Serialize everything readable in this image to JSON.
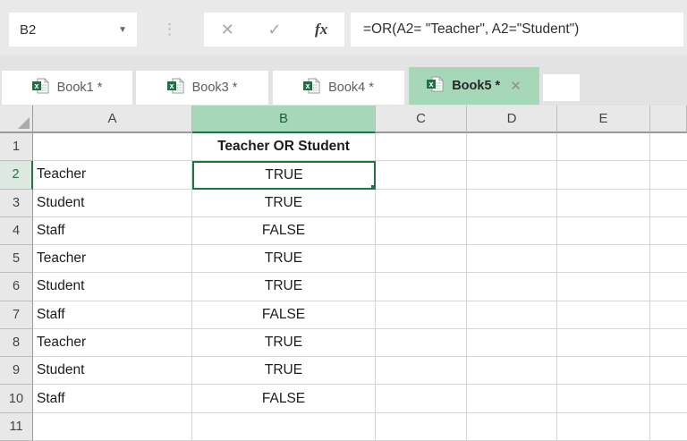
{
  "formula_bar": {
    "name_box_value": "B2",
    "formula": "=OR(A2= \"Teacher\", A2=\"Student\")",
    "fx_label": "fx"
  },
  "icons": {
    "dropdown": "▼",
    "separator_dots": "⋮",
    "cancel": "✕",
    "enter": "✓",
    "tab_close": "✕"
  },
  "tabs": [
    {
      "label": "Book1 *",
      "active": false
    },
    {
      "label": "Book3 *",
      "active": false
    },
    {
      "label": "Book4 *",
      "active": false
    },
    {
      "label": "Book5 *",
      "active": true
    }
  ],
  "grid": {
    "columns": [
      "A",
      "B",
      "C",
      "D",
      "E"
    ],
    "selection": {
      "active_cell": "B2",
      "row": "2",
      "column": "B"
    },
    "rows": [
      {
        "num": "1",
        "a": "",
        "b": "Teacher OR Student"
      },
      {
        "num": "2",
        "a": "Teacher",
        "b": "TRUE"
      },
      {
        "num": "3",
        "a": "Student",
        "b": "TRUE"
      },
      {
        "num": "4",
        "a": "Staff",
        "b": "FALSE"
      },
      {
        "num": "5",
        "a": "Teacher",
        "b": "TRUE"
      },
      {
        "num": "6",
        "a": "Student",
        "b": "TRUE"
      },
      {
        "num": "7",
        "a": "Staff",
        "b": "FALSE"
      },
      {
        "num": "8",
        "a": "Teacher",
        "b": "TRUE"
      },
      {
        "num": "9",
        "a": "Student",
        "b": "TRUE"
      },
      {
        "num": "10",
        "a": "Staff",
        "b": "FALSE"
      },
      {
        "num": "11",
        "a": "",
        "b": ""
      }
    ]
  },
  "colors": {
    "excel_green": "#217346",
    "selection_green": "#a7d7b9"
  }
}
